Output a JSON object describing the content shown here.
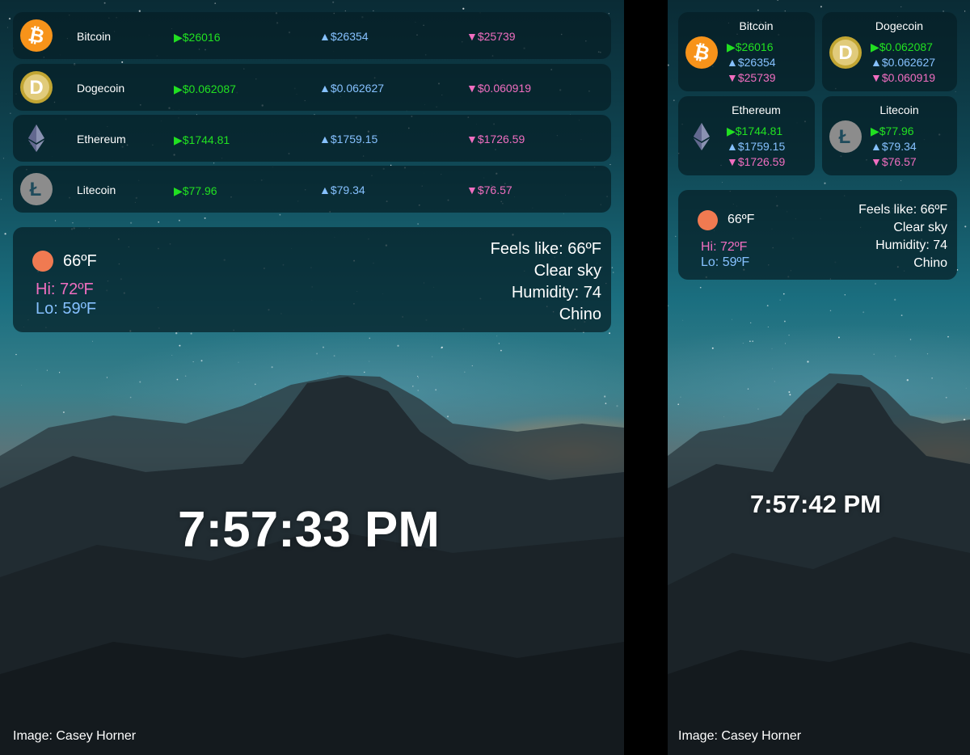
{
  "crypto": [
    {
      "name": "Bitcoin",
      "icon": "bitcoin-icon",
      "price": "▶$26016",
      "high": "▲$26354",
      "low": "▼$25739"
    },
    {
      "name": "Dogecoin",
      "icon": "dogecoin-icon",
      "price": "▶$0.062087",
      "high": "▲$0.062627",
      "low": "▼$0.060919"
    },
    {
      "name": "Ethereum",
      "icon": "ethereum-icon",
      "price": "▶$1744.81",
      "high": "▲$1759.15",
      "low": "▼$1726.59"
    },
    {
      "name": "Litecoin",
      "icon": "litecoin-icon",
      "price": "▶$77.96",
      "high": "▲$79.34",
      "low": "▼$76.57"
    }
  ],
  "weather": {
    "icon": "sun-icon",
    "temp": "66ºF",
    "hi": "Hi: 72ºF",
    "lo": "Lo: 59ºF",
    "feels_like": "Feels like: 66ºF",
    "description": "Clear sky",
    "humidity": "Humidity: 74",
    "location": "Chino"
  },
  "clock": {
    "left": "7:57:33 PM",
    "right": "7:57:42 PM"
  },
  "credit": "Image: Casey Horner",
  "colors": {
    "up": "#21e021",
    "high": "#86c1ff",
    "low": "#f06ec0",
    "sun": "#f07a51",
    "bitcoin": "#f7931a",
    "dogecoin": "#c2a633",
    "ethereum": "#627eea",
    "litecoin": "#8c8c8c"
  }
}
